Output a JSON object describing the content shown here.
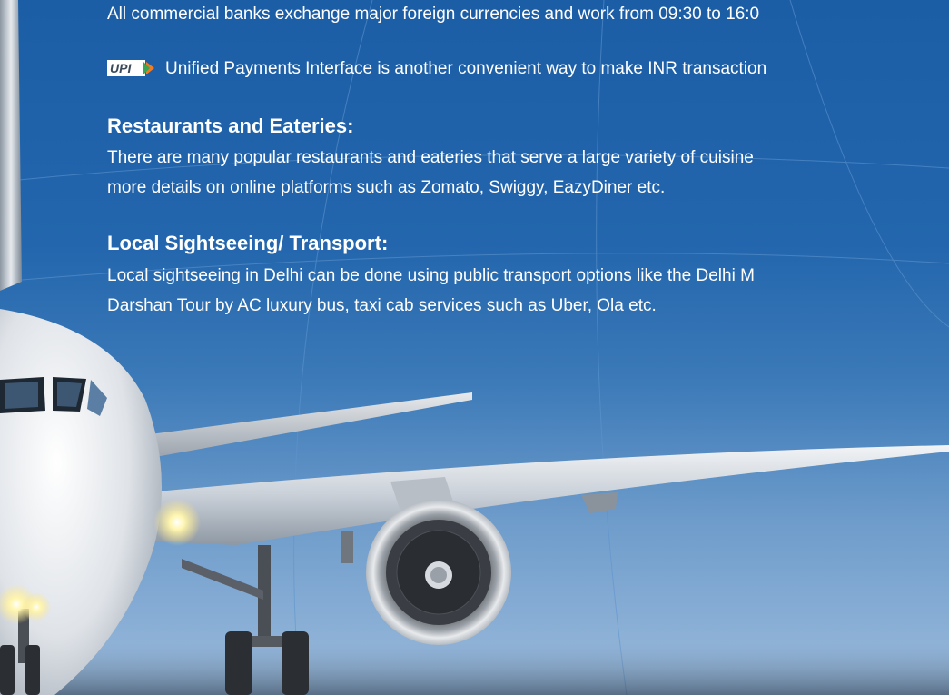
{
  "banking": {
    "text": "All commercial banks exchange major foreign currencies and work from 09:30 to 16:0"
  },
  "upi": {
    "logo_text": "UPI",
    "text": "Unified Payments Interface is another convenient way to make INR transaction"
  },
  "restaurants": {
    "heading": "Restaurants and Eateries:",
    "line1": "There are many popular restaurants and eateries that serve  a large variety  of cuisine",
    "line2": "more details on online platforms such as Zomato, Swiggy, EazyDiner etc."
  },
  "sightseeing": {
    "heading": "Local Sightseeing/ Transport:",
    "line1": "Local sightseeing in Delhi can be done using public transport options like the Delhi M",
    "line2": "Darshan Tour by AC luxury bus, taxi cab services such as Uber, Ola etc."
  },
  "colors": {
    "background_top": "#1c5ea6",
    "background_bottom": "#9cbbdc",
    "text": "#ffffff",
    "upi_orange": "#f47a20",
    "upi_green": "#3aa655"
  },
  "icons": {
    "upi_logo": "upi-logo-icon",
    "airplane": "airplane-illustration"
  }
}
